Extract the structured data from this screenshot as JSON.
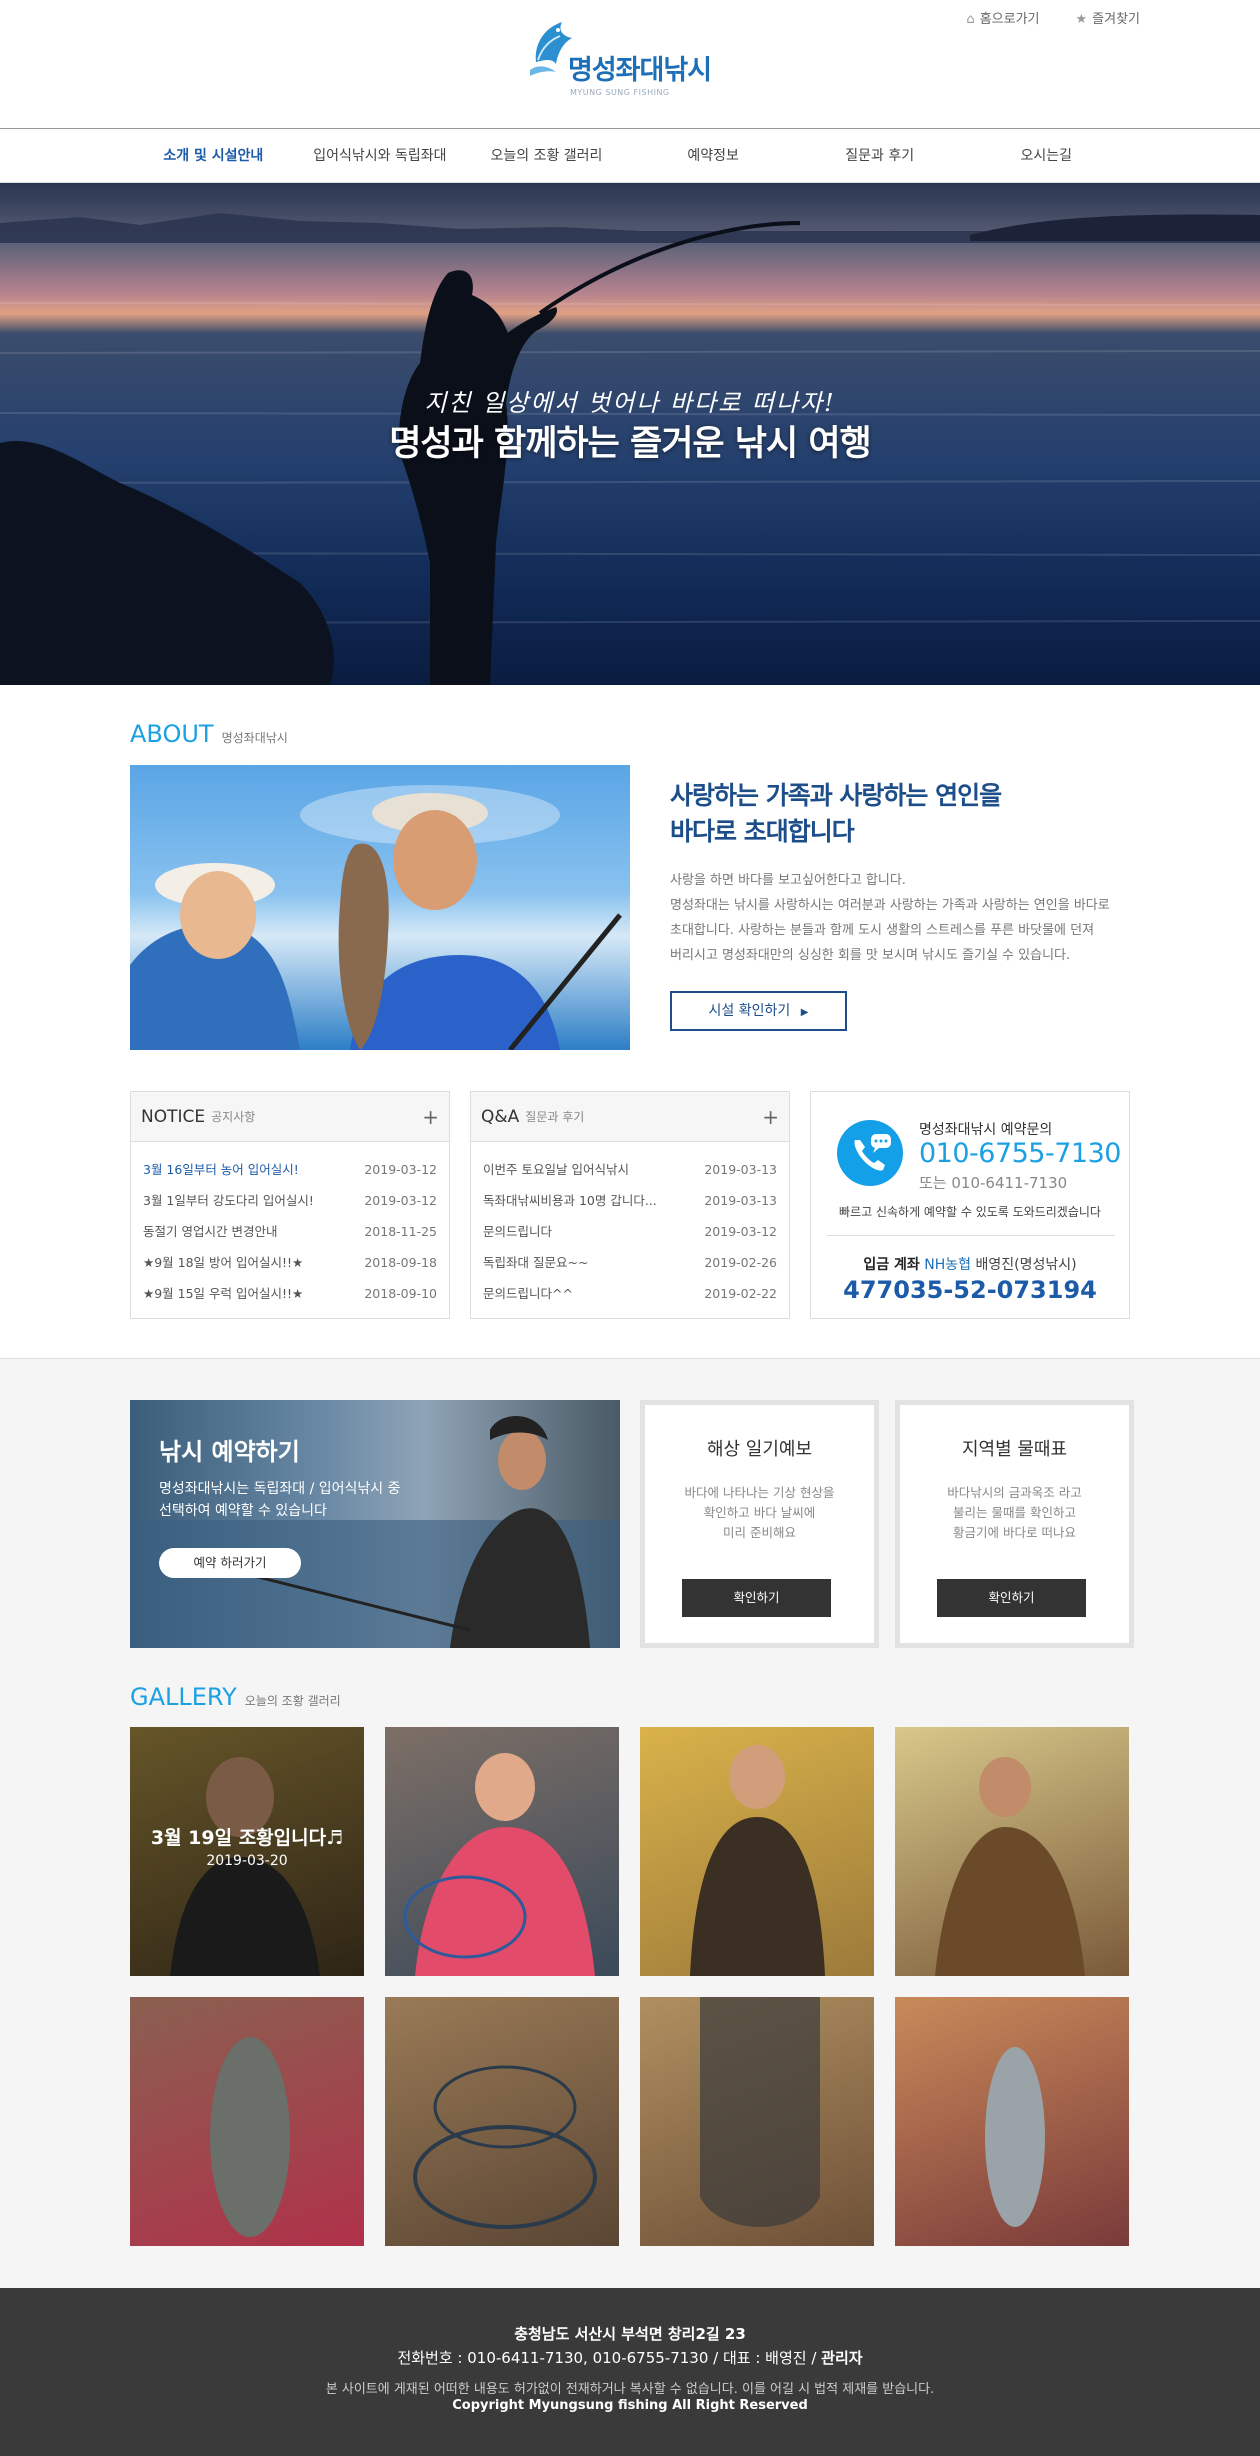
{
  "header": {
    "top_links": [
      {
        "label": "홈으로가기",
        "icon": "home-icon"
      },
      {
        "label": "즐겨찾기",
        "icon": "star-icon"
      }
    ],
    "logo": {
      "name": "명성좌대낚시",
      "sub": "MYUNG SUNG FISHING"
    },
    "nav": [
      {
        "label": "소개 및 시설안내",
        "active": true
      },
      {
        "label": "입어식낚시와 독립좌대",
        "active": false
      },
      {
        "label": "오늘의 조황 갤러리",
        "active": false
      },
      {
        "label": "예약정보",
        "active": false
      },
      {
        "label": "질문과 후기",
        "active": false
      },
      {
        "label": "오시는길",
        "active": false
      }
    ]
  },
  "hero": {
    "subtitle": "지친 일상에서 벗어나 바다로 떠나자!",
    "title": "명성과 함께하는 즐거운 낚시 여행"
  },
  "about": {
    "title_en": "ABOUT",
    "title_ko": "명성좌대낚시",
    "headline_1": "사랑하는 가족과 사랑하는 연인을",
    "headline_2": "바다로 초대합니다",
    "body": [
      "사랑을 하면 바다를 보고싶어한다고 합니다.",
      "명성좌대는 낚시를 사랑하시는 여러분과 사랑하는 가족과 사랑하는 연인을 바다로",
      "초대합니다. 사랑하는 분들과 함께 도시 생활의 스트레스를 푸른 바닷물에 던져",
      "버리시고 명성좌대만의 싱싱한 회를 맛 보시며 낚시도 즐기실 수 있습니다."
    ],
    "button": "시설 확인하기"
  },
  "notice": {
    "title_en": "NOTICE",
    "title_ko": "공지사항",
    "items": [
      {
        "title": "3월 16일부터 농어 입어실시!",
        "date": "2019-03-12"
      },
      {
        "title": "3월 1일부터 강도다리 입어실시!",
        "date": "2019-03-12"
      },
      {
        "title": "동절기 영업시간 변경안내",
        "date": "2018-11-25"
      },
      {
        "title": "★9월 18일 방어 입어실시!!★",
        "date": "2018-09-18"
      },
      {
        "title": "★9월 15일 우럭 입어실시!!★",
        "date": "2018-09-10"
      }
    ]
  },
  "qna": {
    "title_en": "Q&A",
    "title_ko": "질문과 후기",
    "items": [
      {
        "title": "이번주 토요일날 입어식낚시",
        "date": "2019-03-13"
      },
      {
        "title": "독좌대낚씨비용과 10명 갑니다...",
        "date": "2019-03-13"
      },
      {
        "title": "문의드립니다",
        "date": "2019-03-12"
      },
      {
        "title": "독립좌대 질문요~~",
        "date": "2019-02-26"
      },
      {
        "title": "문의드립니다^^",
        "date": "2019-02-22"
      }
    ]
  },
  "contact": {
    "label": "명성좌대낚시 예약문의",
    "phone_main": "010-6755-7130",
    "phone_alt": "또는 010-6411-7130",
    "note": "빠르고 신속하게 예약할 수 있도록 도와드리겠습니다",
    "account_label": "입금 계좌",
    "bank": "NH농협",
    "holder": "배영진(명성낚시)",
    "account_no": "477035-52-073194"
  },
  "booking": {
    "title": "낚시 예약하기",
    "desc_1": "명성좌대낚시는 독립좌대 / 입어식낚시 중",
    "desc_2": "선택하여 예약할 수 있습니다",
    "button": "예약 하러가기"
  },
  "weather": {
    "title": "해상 일기예보",
    "desc": [
      "바다에 나타나는 기상 현상을",
      "확인하고 바다 날씨에",
      "미리 준비해요"
    ],
    "button": "확인하기"
  },
  "tide": {
    "title": "지역별 물때표",
    "desc": [
      "바다낚시의 금과옥조 라고",
      "불리는 물때를 확인하고",
      "황금기에 바다로 떠나요"
    ],
    "button": "확인하기"
  },
  "gallery": {
    "title_en": "GALLERY",
    "title_ko": "오늘의 조황 갤러리",
    "featured_title": "3월 19일 조황입니다♬",
    "featured_date": "2019-03-20"
  },
  "footer": {
    "address": "충청남도 서산시 부석면 창리2길 23",
    "phone_line": "전화번호 : 010-6411-7130, 010-6755-7130   /   대표 : 배영진   /",
    "admin": "관리자",
    "notice": "본 사이트에 게재된 어떠한 내용도 허가없이 전재하거나 복사할 수 없습니다. 이를 어길 시 법적 제재를 받습니다.",
    "copyright": "Copyright Myungsung fishing All Right Reserved"
  },
  "colors": {
    "accent": "#1ba0e2",
    "navy": "#1d5ba8",
    "footer_bg": "#3a3a3a"
  }
}
